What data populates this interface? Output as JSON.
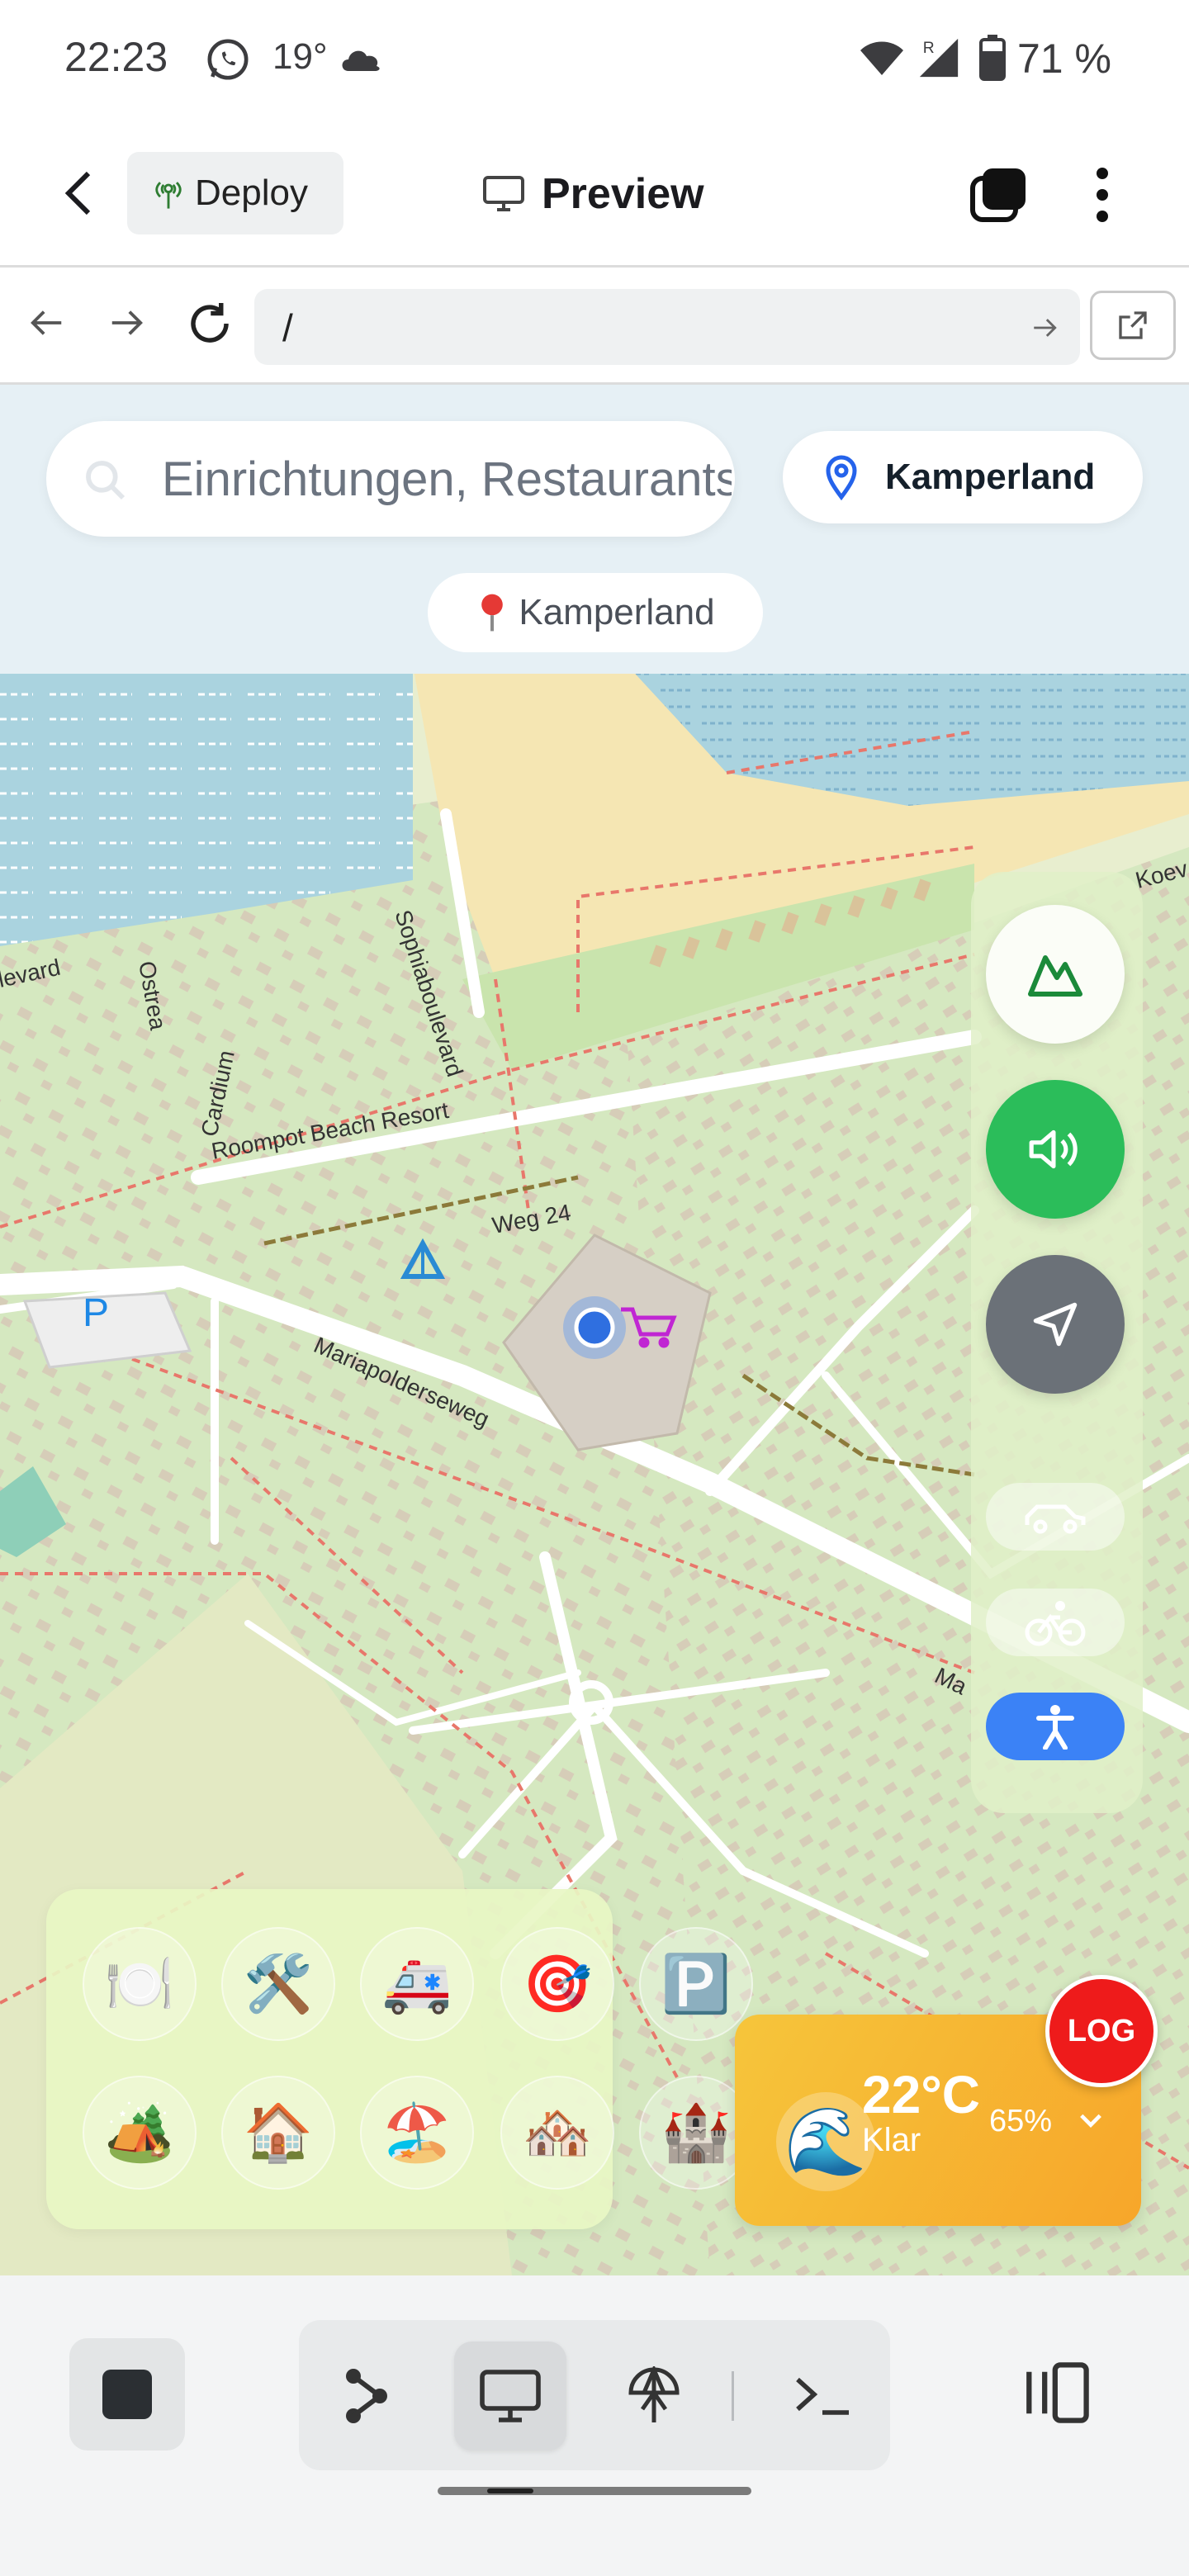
{
  "status_bar": {
    "time": "22:23",
    "temperature": "19°",
    "battery": "71 %",
    "icons": [
      "whatsapp-icon",
      "cloud-icon",
      "wifi-icon",
      "signal-icon",
      "battery-icon"
    ]
  },
  "header": {
    "deploy_label": "Deploy",
    "title": "Preview"
  },
  "urlbar": {
    "url": "/"
  },
  "map": {
    "search_placeholder": "Einrichtungen, Restaurants",
    "location_button": "Kamperland",
    "location_chip": "Kamperland",
    "labels": {
      "sophiaboulevard": "Sophiaboulevard",
      "levard": "levard",
      "ostrea": "Ostrea",
      "cardium": "Cardium",
      "roompot": "Roompot Beach Resort",
      "weg24": "Weg 24",
      "mariapoldersweg": "Mariapolderseweg",
      "koev": "Koev",
      "ma": "Ma",
      "parking": "P"
    },
    "categories": [
      {
        "name": "restaurant",
        "glyph": "🍽️"
      },
      {
        "name": "tools",
        "glyph": "🛠️"
      },
      {
        "name": "ambulance",
        "glyph": "🚑"
      },
      {
        "name": "activities",
        "glyph": "🎯"
      },
      {
        "name": "parking",
        "glyph": "🅿️"
      },
      {
        "name": "camping",
        "glyph": "🏕️"
      },
      {
        "name": "house",
        "glyph": "🏠"
      },
      {
        "name": "beach",
        "glyph": "🏖️"
      },
      {
        "name": "houses",
        "glyph": "🏘️"
      },
      {
        "name": "castle",
        "glyph": "🏰"
      }
    ]
  },
  "weather": {
    "temperature": "22°C",
    "humidity": "65%",
    "condition": "Klar",
    "icon": "🌊"
  },
  "log_label": "LOG",
  "colors": {
    "accent_blue": "#3b82f6",
    "sound_green": "#2bbd5a",
    "log_red": "#ee1b1b",
    "weather_orange": "#f6b33a"
  }
}
